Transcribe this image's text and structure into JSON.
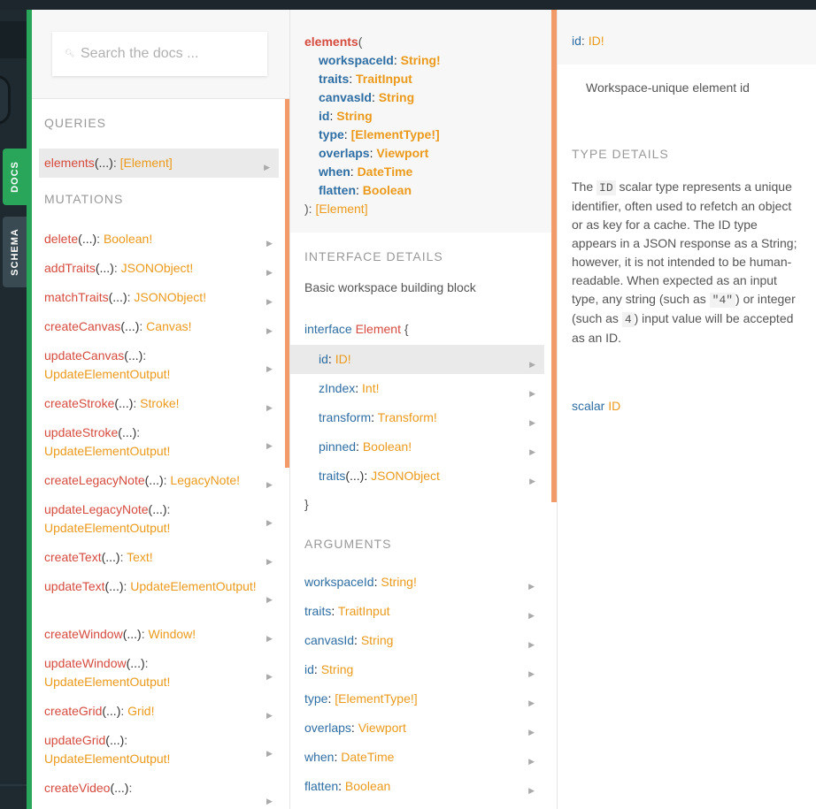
{
  "nav": {
    "docs_tab": "DOCS",
    "schema_tab": "SCHEMA"
  },
  "explorer": {
    "search_placeholder": "Search the docs ...",
    "queries_title": "QUERIES",
    "queries": [
      {
        "name": "elements",
        "args": "(...)",
        "sep": ":",
        "type": "[Element]"
      }
    ],
    "mutations_title": "MUTATIONS",
    "mutations": [
      {
        "name": "delete",
        "args": "(...)",
        "sep": ":",
        "type": "Boolean!"
      },
      {
        "name": "addTraits",
        "args": "(...)",
        "sep": ":",
        "type": "JSONObject!"
      },
      {
        "name": "matchTraits",
        "args": "(...)",
        "sep": ":",
        "type": "JSONObject!"
      },
      {
        "name": "createCanvas",
        "args": "(...)",
        "sep": ":",
        "type": "Canvas!"
      },
      {
        "name": "updateCanvas",
        "args": "(...)",
        "sep": ":",
        "type": "UpdateElementOutput!"
      },
      {
        "name": "createStroke",
        "args": "(...)",
        "sep": ":",
        "type": "Stroke!"
      },
      {
        "name": "updateStroke",
        "args": "(...)",
        "sep": ":",
        "type": "UpdateElementOutput!"
      },
      {
        "name": "createLegacyNote",
        "args": "(...)",
        "sep": ":",
        "type": "LegacyNote!"
      },
      {
        "name": "updateLegacyNote",
        "args": "(...)",
        "sep": ":",
        "type": "UpdateElementOutput!"
      },
      {
        "name": "createText",
        "args": "(...)",
        "sep": ":",
        "type": "Text!"
      },
      {
        "name": "updateText",
        "args": "(...)",
        "sep": ":",
        "type": "UpdateElementOutput!"
      },
      {
        "name": "createWindow",
        "args": "(...)",
        "sep": ":",
        "type": "Window!"
      },
      {
        "name": "updateWindow",
        "args": "(...)",
        "sep": ":",
        "type": "UpdateElementOutput!"
      },
      {
        "name": "createGrid",
        "args": "(...)",
        "sep": ":",
        "type": "Grid!"
      },
      {
        "name": "updateGrid",
        "args": "(...)",
        "sep": ":",
        "type": "UpdateElementOutput!"
      },
      {
        "name": "createVideo",
        "args": "(...)",
        "sep": ":",
        "type": ""
      }
    ]
  },
  "field_detail": {
    "signature": {
      "name": "elements",
      "open": "(",
      "close": "):",
      "return_type": "[Element]",
      "args": [
        {
          "name": "workspaceId",
          "type": "String!"
        },
        {
          "name": "traits",
          "type": "TraitInput"
        },
        {
          "name": "canvasId",
          "type": "String"
        },
        {
          "name": "id",
          "type": "String"
        },
        {
          "name": "type",
          "type": "[ElementType!]"
        },
        {
          "name": "overlaps",
          "type": "Viewport"
        },
        {
          "name": "when",
          "type": "DateTime"
        },
        {
          "name": "flatten",
          "type": "Boolean"
        }
      ]
    },
    "interface_title": "INTERFACE DETAILS",
    "interface_desc": "Basic workspace building block",
    "interface_kw": "interface",
    "interface_name": "Element",
    "open_brace": "{",
    "close_brace": "}",
    "interface_fields": [
      {
        "name": "id",
        "args": "",
        "type": "ID!"
      },
      {
        "name": "zIndex",
        "args": "",
        "type": "Int!"
      },
      {
        "name": "transform",
        "args": "",
        "type": "Transform!"
      },
      {
        "name": "pinned",
        "args": "",
        "type": "Boolean!"
      },
      {
        "name": "traits",
        "args": "(...)",
        "type": "JSONObject"
      }
    ],
    "arguments_title": "ARGUMENTS",
    "arguments": [
      {
        "name": "workspaceId",
        "type": "String!"
      },
      {
        "name": "traits",
        "type": "TraitInput"
      },
      {
        "name": "canvasId",
        "type": "String"
      },
      {
        "name": "id",
        "type": "String"
      },
      {
        "name": "type",
        "type": "[ElementType!]"
      },
      {
        "name": "overlaps",
        "type": "Viewport"
      },
      {
        "name": "when",
        "type": "DateTime"
      },
      {
        "name": "flatten",
        "type": "Boolean"
      }
    ]
  },
  "type_detail": {
    "field_name": "id",
    "field_type": "ID!",
    "field_desc": "Workspace-unique element id",
    "type_details_title": "TYPE DETAILS",
    "desc_parts": {
      "p1": "The ",
      "code1": "ID",
      "p2": " scalar type represents a unique identifier, often used to refetch an object or as key for a cache. The ID type appears in a JSON response as a String; however, it is not intended to be human-readable. When expected as an input type, any string (such as ",
      "code2": "\"4\"",
      "p3": ") or integer (such as ",
      "code3": "4",
      "p4": ") input value will be accepted as an ID."
    },
    "scalar_kw": "scalar",
    "scalar_name": "ID"
  },
  "colors": {
    "accent_green": "#2aa65b",
    "field_name": "#d64b3f",
    "type_name": "#eb9a1b",
    "arg_name": "#2f6ea3",
    "scroll_marker": "#f29a6a"
  }
}
